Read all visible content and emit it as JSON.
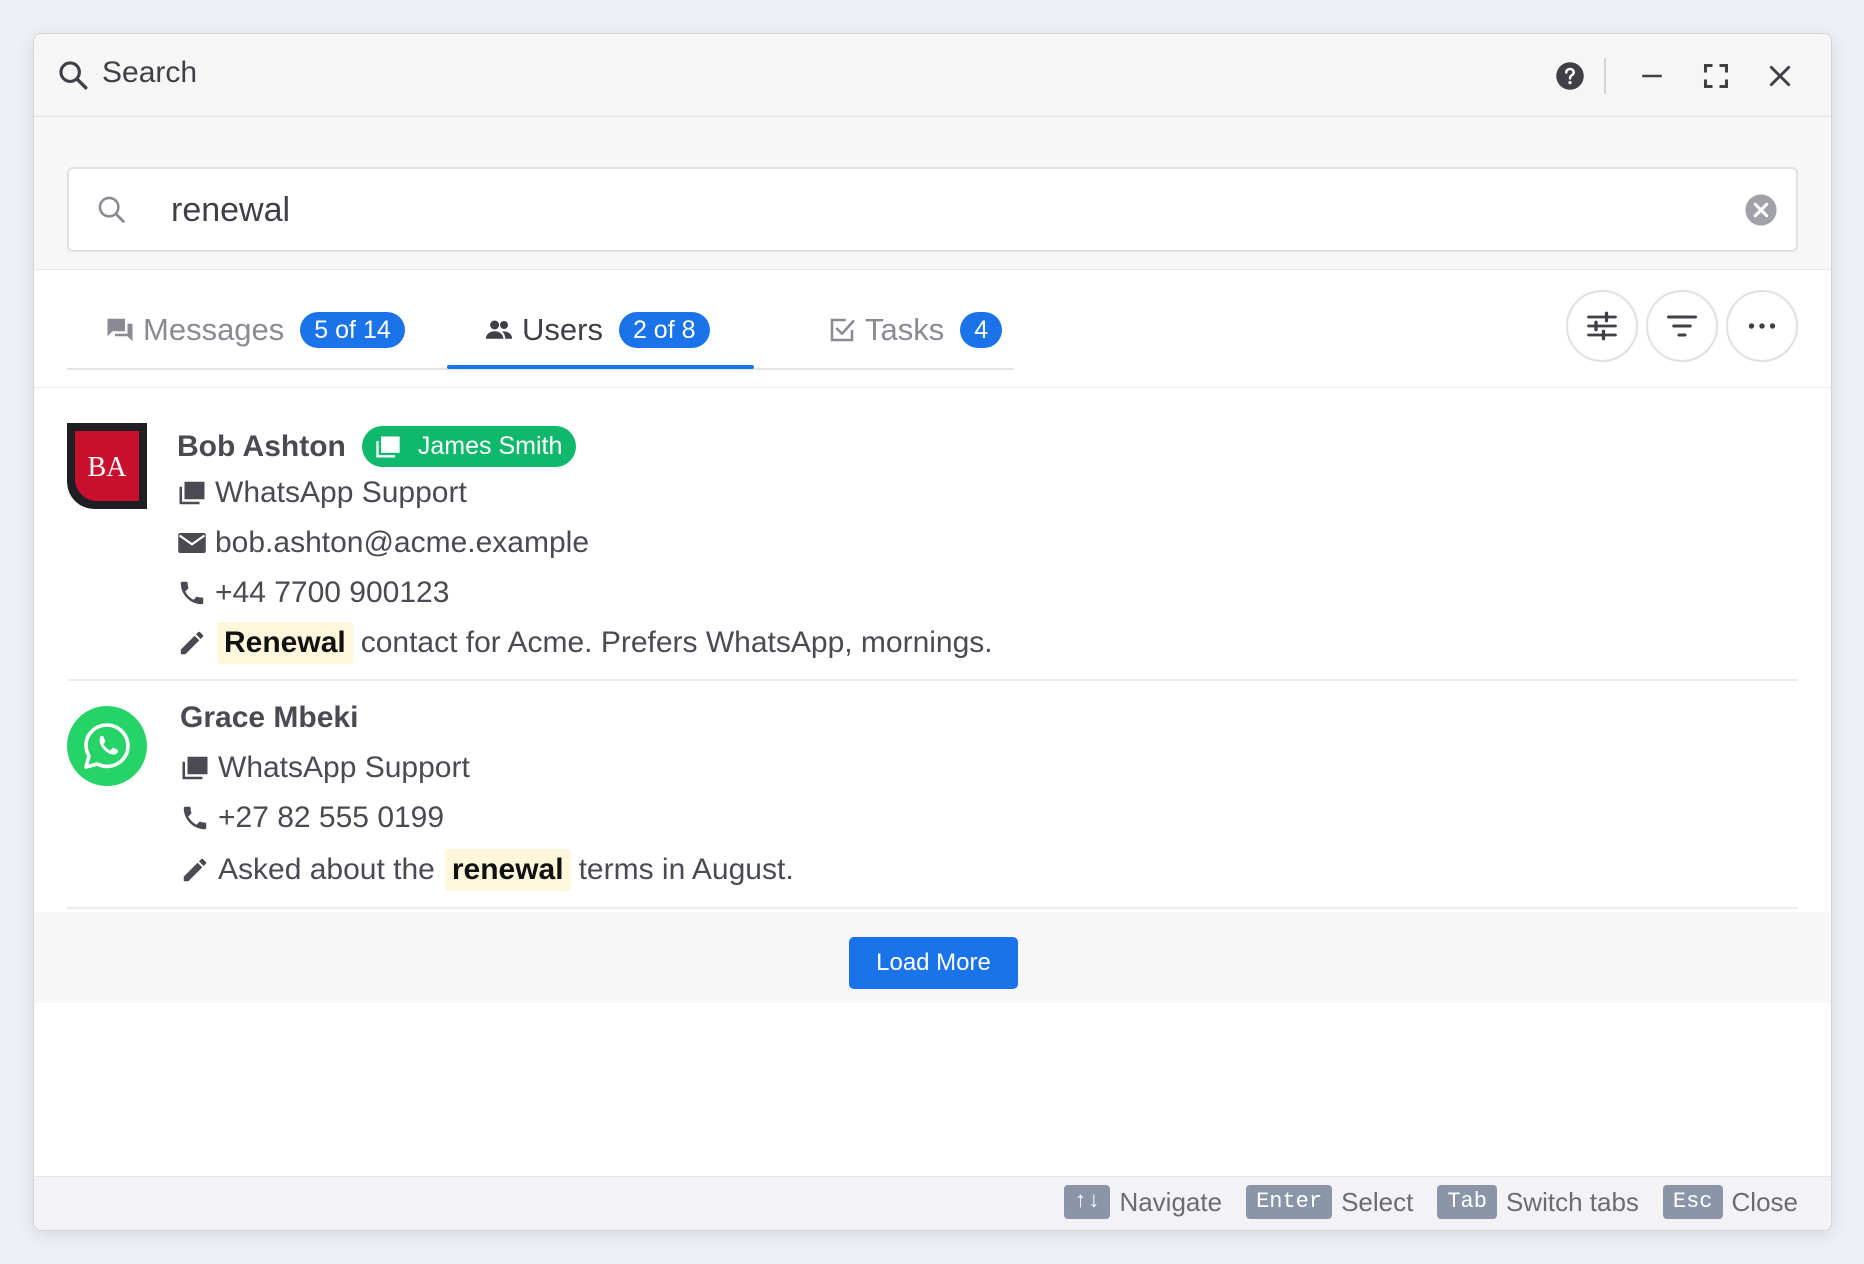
{
  "window": {
    "title": "Search"
  },
  "search": {
    "query": "renewal",
    "placeholder": ""
  },
  "tabs": [
    {
      "label": "Messages",
      "badge": "5 of 14",
      "icon": "chat-bubbles-icon",
      "active": false
    },
    {
      "label": "Users",
      "badge": "2 of 8",
      "icon": "users-icon",
      "active": true
    },
    {
      "label": "Tasks",
      "badge": "4",
      "icon": "checkbox-icon",
      "active": false
    }
  ],
  "toolbar_icons": [
    "sliders-icon",
    "filter-icon",
    "more-icon"
  ],
  "results": [
    {
      "name": "Bob Ashton",
      "avatar_initials": "BA",
      "assignee": "James Smith",
      "channel": "WhatsApp Support",
      "email": "bob.ashton@acme.example",
      "phone": "+44 7700 900123",
      "note_highlight": "Renewal",
      "note_rest": "contact for Acme. Prefers WhatsApp, mornings."
    },
    {
      "name": "Grace Mbeki",
      "channel": "WhatsApp Support",
      "phone": "+27 82 555 0199",
      "note_before": "Asked about the",
      "note_highlight": "renewal",
      "note_after": "terms in August."
    }
  ],
  "load_more_label": "Load More",
  "hints": [
    {
      "key": "↑↓",
      "label": "Navigate"
    },
    {
      "key": "Enter",
      "label": "Select"
    },
    {
      "key": "Tab",
      "label": "Switch tabs"
    },
    {
      "key": "Esc",
      "label": "Close"
    }
  ],
  "colors": {
    "accent": "#1a73e8",
    "assignee_pill": "#0fb86b",
    "whatsapp": "#25d366",
    "avatar_red": "#c8102e",
    "highlight_bg": "#fff7dc"
  }
}
